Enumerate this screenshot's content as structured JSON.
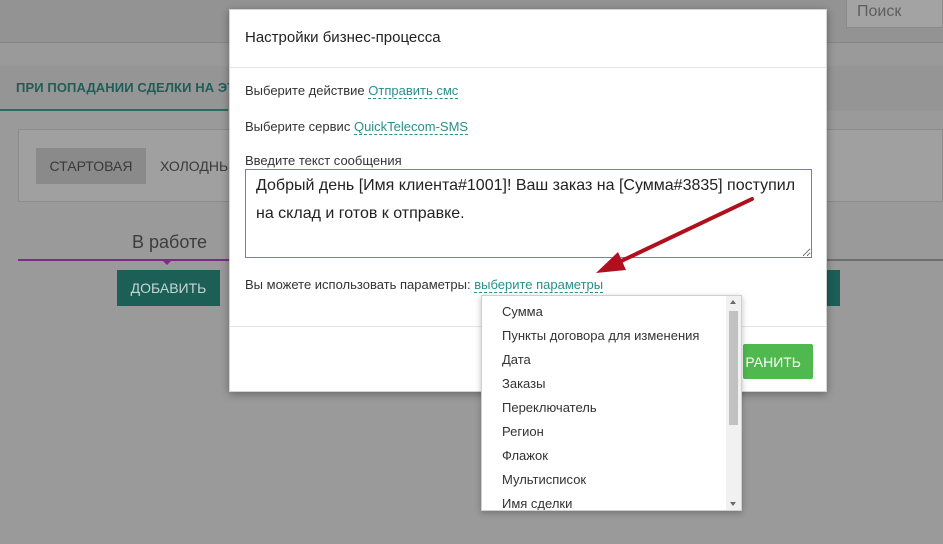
{
  "background": {
    "search_placeholder": "Поиск",
    "tab_label": "ПРИ ПОПАДАНИИ СДЕЛКИ НА ЭТА",
    "stage_start": "СТАРТОВАЯ",
    "stage_cold": "ХОЛОДНЫ",
    "column_title": "В работе",
    "add_button": "ДОБАВИТЬ"
  },
  "modal": {
    "title": "Настройки бизнес-процесса",
    "action_label": "Выберите действие",
    "action_value": "Отправить смс",
    "service_label": "Выберите сервис",
    "service_value": "QuickTelecom-SMS",
    "message_label": "Введите текст сообщения",
    "message_value": "Добрый день [Имя клиента#1001]! Ваш заказ на [Сумма#3835] поступил на склад и готов к отправке.",
    "params_label": "Вы можете использовать параметры:",
    "params_link": "выберите параметры",
    "save_button": "РАНИТЬ"
  },
  "dropdown": {
    "items": [
      "Сумма",
      "Пункты договора для изменения",
      "Дата",
      "Заказы",
      "Переключатель",
      "Регион",
      "Флажок",
      "Мультисписок",
      "Имя сделки"
    ]
  },
  "colors": {
    "accent": "#2a8f8a",
    "save": "#4fb84f",
    "annotation_arrow": "#b0101e"
  },
  "icons": {
    "scroll_up": "triangle-up-icon",
    "scroll_down": "triangle-down-icon",
    "resize": "resize-grip-icon"
  }
}
